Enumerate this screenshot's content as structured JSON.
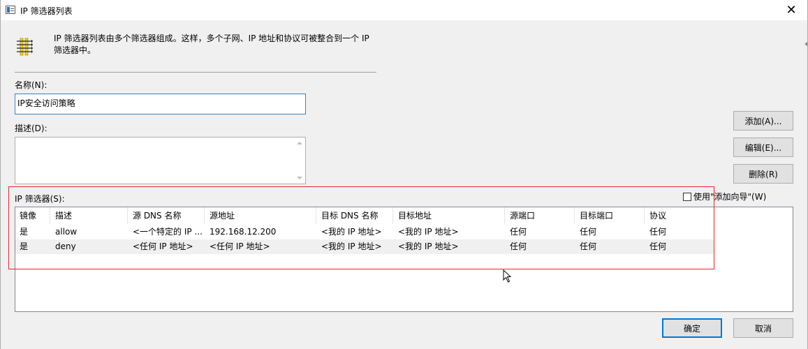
{
  "window": {
    "title": "IP 筛选器列表",
    "close_glyph": "✕"
  },
  "intro": {
    "line1": "IP 筛选器列表由多个筛选器组成。这样，多个子网、IP 地址和协议可被整合到一个 IP",
    "line2": "筛选器中。"
  },
  "name": {
    "label": "名称(N):",
    "value": "IP安全访问策略"
  },
  "description": {
    "label": "描述(D):",
    "value": ""
  },
  "buttons": {
    "add": "添加(A)...",
    "edit": "编辑(E)...",
    "delete": "删除(R)",
    "ok": "确定",
    "cancel": "取消"
  },
  "filters": {
    "label": "IP 筛选器(S):",
    "wizard_checkbox": {
      "label": "使用\"添加向导\"(W)",
      "checked": false
    },
    "columns": [
      "镜像",
      "描述",
      "源 DNS 名称",
      "源地址",
      "目标 DNS 名称",
      "目标地址",
      "源端口",
      "目标端口",
      "协议"
    ],
    "rows": [
      [
        "是",
        "allow",
        "<一个特定的 IP ...",
        "192.168.12.200",
        "<我的 IP 地址>",
        "<我的 IP 地址>",
        "任何",
        "任何",
        "任何"
      ],
      [
        "是",
        "deny",
        "<任何 IP 地址>",
        "<任何 IP 地址>",
        "<我的 IP 地址>",
        "<我的 IP 地址>",
        "任何",
        "任何",
        "任何"
      ]
    ]
  },
  "colors": {
    "accent": "#0078d7",
    "highlight_box": "#e0282e",
    "focus_border": "#3c7fb1"
  }
}
